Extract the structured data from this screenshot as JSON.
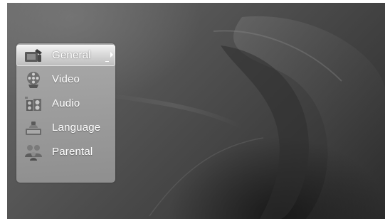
{
  "settings_menu": {
    "items": [
      {
        "label": "General",
        "icon": "general-settings-icon",
        "selected": true
      },
      {
        "label": "Video",
        "icon": "video-film-reel-icon",
        "selected": false
      },
      {
        "label": "Audio",
        "icon": "audio-speaker-icon",
        "selected": false
      },
      {
        "label": "Language",
        "icon": "language-icon",
        "selected": false
      },
      {
        "label": "Parental",
        "icon": "parental-family-icon",
        "selected": false
      }
    ]
  },
  "colors": {
    "background_dark": "#2a2a2a",
    "background_light": "#6a6a6a",
    "panel": "#a8a8a8",
    "selected_highlight": "#e6e6e6",
    "text": "#ffffff"
  }
}
